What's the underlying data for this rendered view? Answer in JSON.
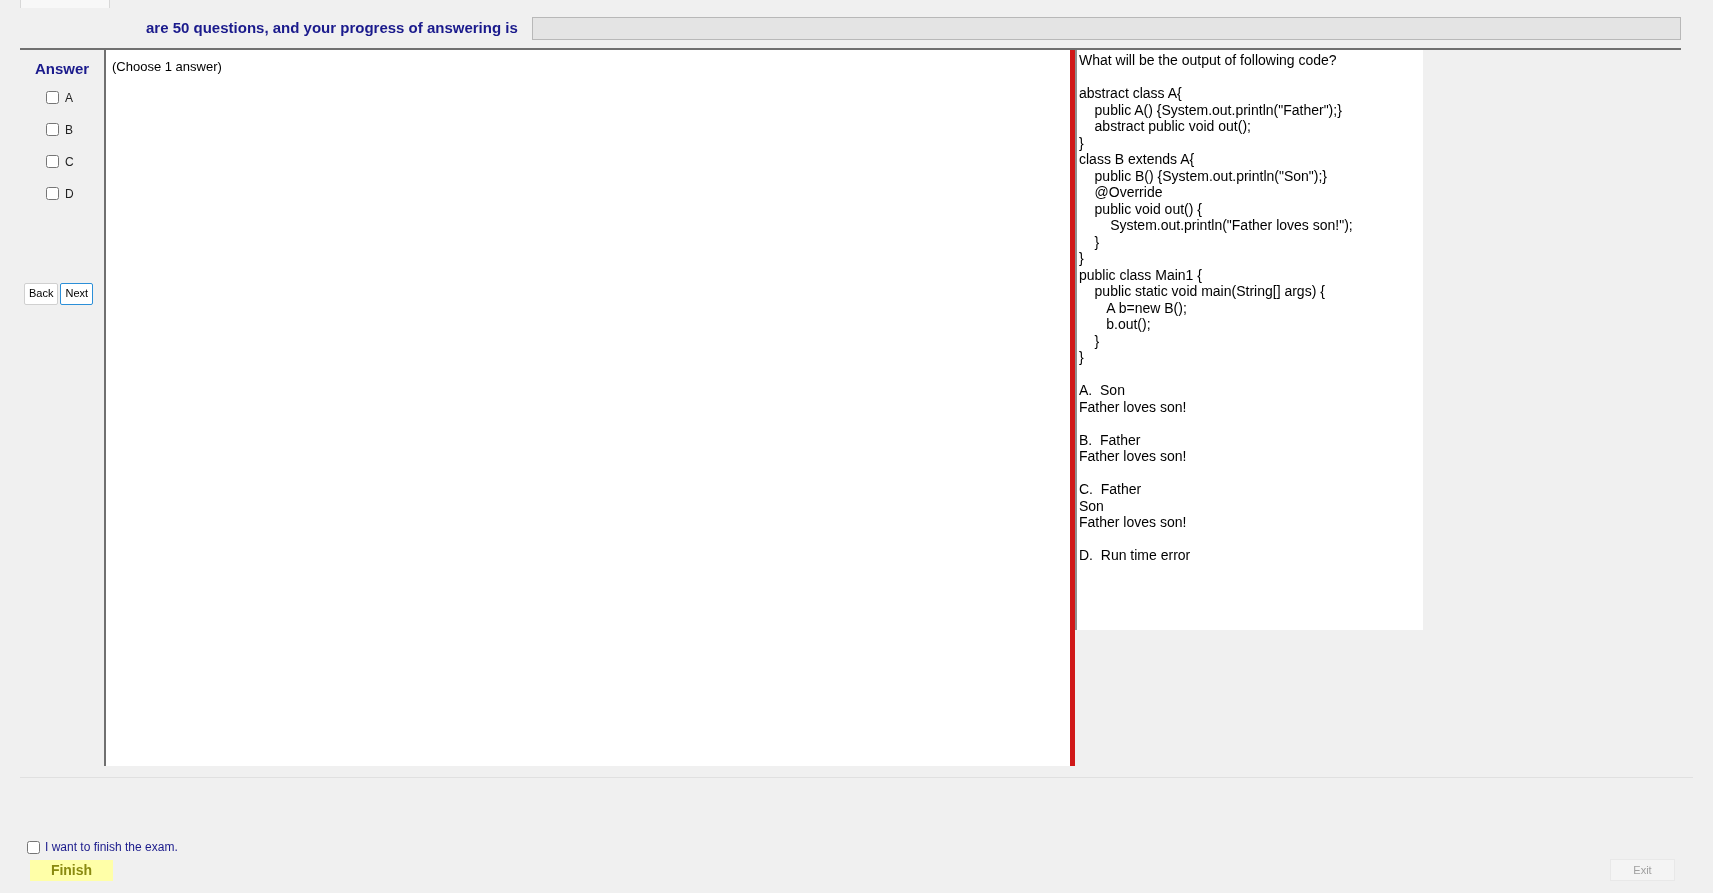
{
  "header": {
    "text": "are 50 questions, and your progress of answering is",
    "progress": {
      "level": 0
    }
  },
  "answer_panel": {
    "title": "Answer",
    "options": [
      {
        "label": "A",
        "checked": false
      },
      {
        "label": "B",
        "checked": false
      },
      {
        "label": "C",
        "checked": false
      },
      {
        "label": "D",
        "checked": false
      }
    ],
    "buttons": [
      {
        "label": "Back",
        "focused": false
      },
      {
        "label": "Next",
        "focused": true
      }
    ]
  },
  "answer_area": {
    "text": "(Choose 1 answer)"
  },
  "question": {
    "text": "What will be the output of following code?\n\nabstract class A{\n    public A() {System.out.println(\"Father\");}\n    abstract public void out();\n}\nclass B extends A{\n    public B() {System.out.println(\"Son\");}\n    @Override\n    public void out() {\n        System.out.println(\"Father loves son!\");\n    }\n}\npublic class Main1 {\n    public static void main(String[] args) {\n       A b=new B();\n       b.out();\n    }\n}\n\nA.  Son\nFather loves son!\n\nB.  Father\nFather loves son!\n\nC.  Father\nSon\nFather loves son!\n\nD.  Run time error"
  },
  "footer": {
    "finish_check": {
      "label": "I want to finish the exam.",
      "checked": false
    },
    "finish_button": "Finish",
    "exit_button": "Exit"
  }
}
